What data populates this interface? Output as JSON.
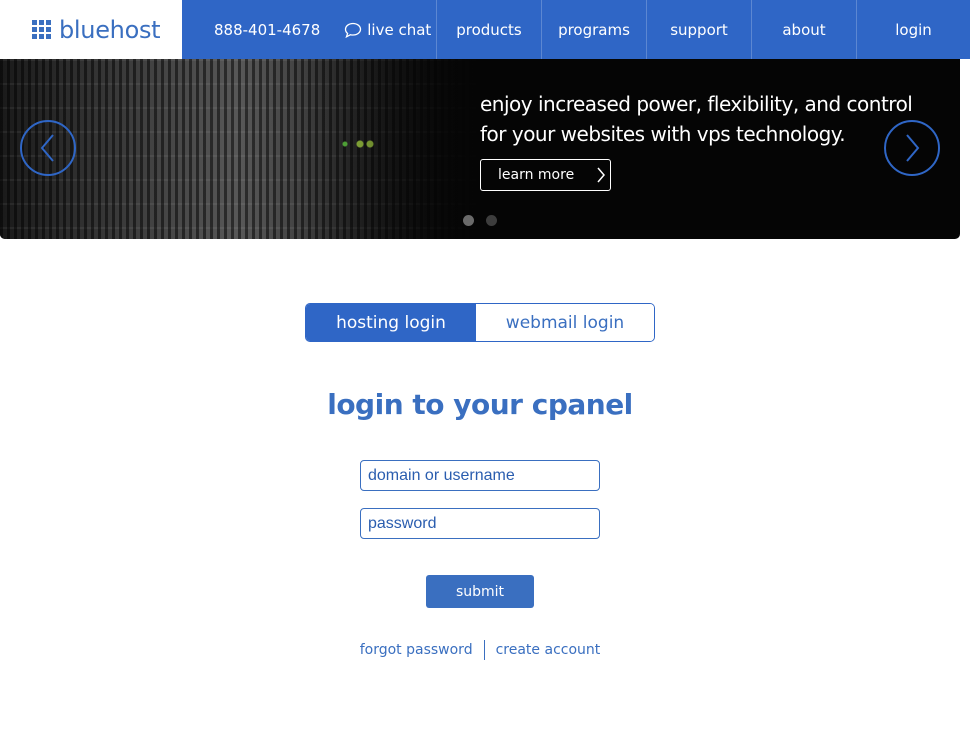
{
  "header": {
    "logo_text": "bluehost",
    "phone": "888-401-4678",
    "chat_label": "live chat",
    "nav": [
      "products",
      "programs",
      "support",
      "about",
      "login"
    ]
  },
  "hero": {
    "headline": "enjoy increased power, flexibility, and control for your websites with vps technology.",
    "button_label": "learn more",
    "slide_count": 2,
    "active_slide": 1
  },
  "login": {
    "tabs": [
      "hosting login",
      "webmail login"
    ],
    "active_tab": "hosting login",
    "title": "login to your cpanel",
    "username_placeholder": "domain or username",
    "username_value": "",
    "password_placeholder": "password",
    "password_value": "",
    "submit_label": "submit",
    "forgot_label": "forgot password",
    "create_label": "create account"
  },
  "colors": {
    "brand_blue": "#2f66c6",
    "text_blue": "#3a6fc0",
    "hero_bg": "#050505"
  },
  "icons": [
    "grid-logo-icon",
    "chat-bubble-icon",
    "chevron-left-icon",
    "chevron-right-icon"
  ]
}
